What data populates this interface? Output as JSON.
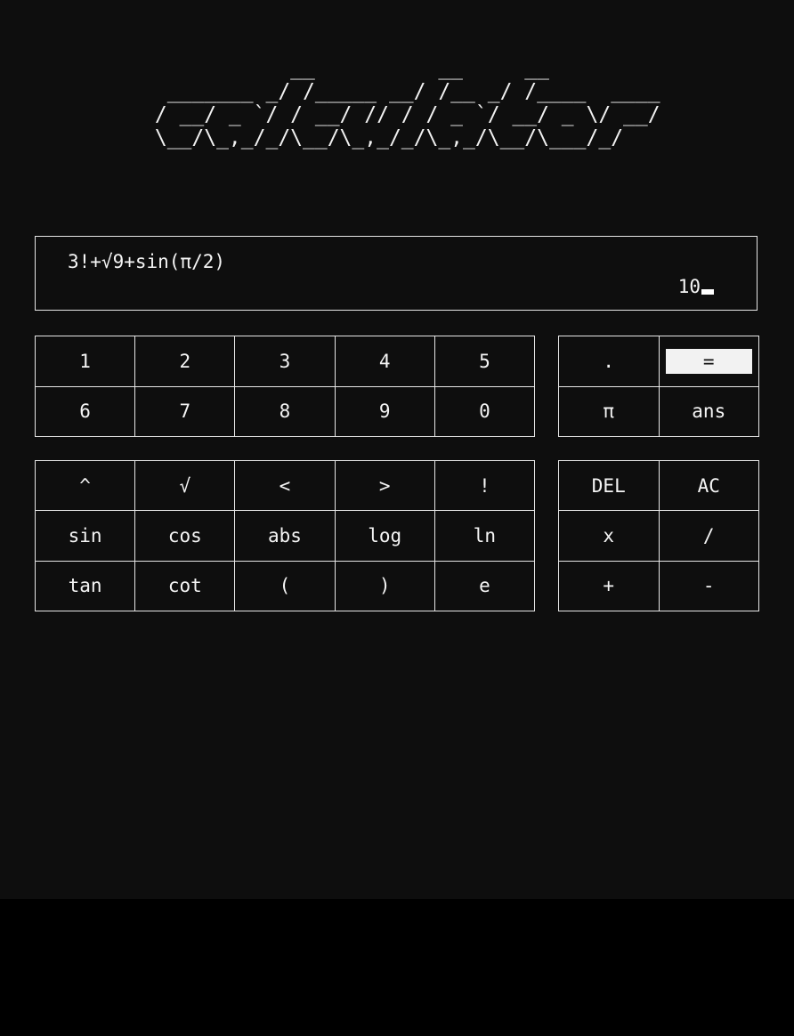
{
  "logo": {
    "art": "            __          __     __\n  _______ _/ /_____ __/ /__ _/ /____  ____\n / __/ _ `/ / __/ // / / _ `/ __/ _ \\/ __/\n \\__/\\_,_/_/\\__/\\_,_/_/\\_,_/\\__/\\___/_/"
  },
  "display": {
    "expression": "3!+√9+sin(π/2)",
    "result": "10"
  },
  "digits": {
    "k1": "1",
    "k2": "2",
    "k3": "3",
    "k4": "4",
    "k5": "5",
    "k6": "6",
    "k7": "7",
    "k8": "8",
    "k9": "9",
    "k0": "0"
  },
  "extra": {
    "dot": ".",
    "equals": "=",
    "pi": "π",
    "ans": "ans"
  },
  "funcs": {
    "power": "^",
    "sqrt": "√",
    "less": "<",
    "greater": ">",
    "factorial": "!",
    "sin": "sin",
    "cos": "cos",
    "abs": "abs",
    "log": "log",
    "ln": "ln",
    "tan": "tan",
    "cot": "cot",
    "lparen": "(",
    "rparen": ")",
    "e": "e"
  },
  "ops": {
    "del": "DEL",
    "ac": "AC",
    "multiply": "x",
    "divide": "/",
    "plus": "+",
    "minus": "-"
  },
  "colors": {
    "background": "#0e0e0e",
    "foreground": "#f5f5f5",
    "border": "#e6e6e6"
  }
}
